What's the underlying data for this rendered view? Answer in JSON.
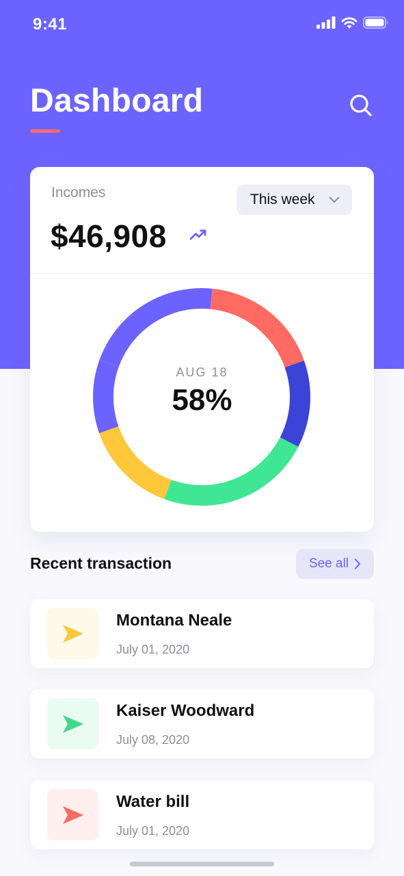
{
  "status_bar": {
    "time": "9:41"
  },
  "header": {
    "title": "Dashboard",
    "accent_color": "#FF6B6B",
    "background_color": "#6C63FF"
  },
  "search": {
    "icon": "search-icon"
  },
  "income_card": {
    "label": "Incomes",
    "amount": "$46,908",
    "trend_icon": "trending-up-icon",
    "period": {
      "selected": "This week",
      "icon": "chevron-down-icon"
    },
    "donut": {
      "date": "AUG 18",
      "percent": "58%",
      "segments": [
        {
          "color": "#6C63FF",
          "fraction": 0.21
        },
        {
          "color": "#FF6B63",
          "fraction": 0.18
        },
        {
          "color": "#3B44D6",
          "fraction": 0.13
        },
        {
          "color": "#40E793",
          "fraction": 0.23
        },
        {
          "color": "#FFC83A",
          "fraction": 0.14
        },
        {
          "color": "#6C63FF",
          "fraction": 0.11
        }
      ]
    }
  },
  "transactions": {
    "title": "Recent transaction",
    "see_all": "See all",
    "see_all_icon": "chevron-right-icon",
    "items": [
      {
        "name": "Montana Neale",
        "date": "July 01, 2020",
        "icon": "send-icon",
        "color": "#FFC83A",
        "bg": "#FFF9EA"
      },
      {
        "name": "Kaiser Woodward",
        "date": "July 08, 2020",
        "icon": "send-icon",
        "color": "#3FD98A",
        "bg": "#EAFBF2"
      },
      {
        "name": "Water bill",
        "date": "July 01, 2020",
        "icon": "send-icon",
        "color": "#FF6B63",
        "bg": "#FFEFEE"
      }
    ]
  }
}
